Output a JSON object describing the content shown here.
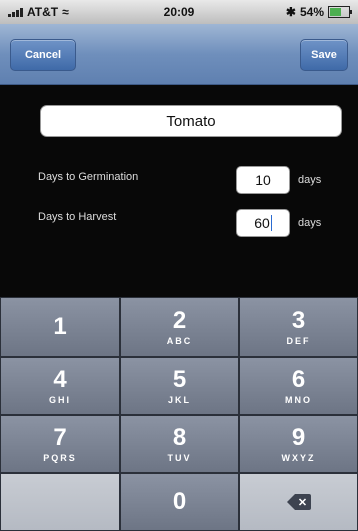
{
  "status_bar": {
    "carrier": "AT&T",
    "time": "20:09",
    "battery_text": "54%"
  },
  "nav": {
    "cancel_label": "Cancel",
    "save_label": "Save"
  },
  "form": {
    "name_value": "Tomato",
    "germination_label": "Days to Germination",
    "germination_value": "10",
    "harvest_label": "Days to Harvest",
    "harvest_value": "60",
    "unit": "days"
  },
  "keypad": {
    "keys": [
      {
        "digit": "1",
        "letters": ""
      },
      {
        "digit": "2",
        "letters": "ABC"
      },
      {
        "digit": "3",
        "letters": "DEF"
      },
      {
        "digit": "4",
        "letters": "GHI"
      },
      {
        "digit": "5",
        "letters": "JKL"
      },
      {
        "digit": "6",
        "letters": "MNO"
      },
      {
        "digit": "7",
        "letters": "PQRS"
      },
      {
        "digit": "8",
        "letters": "TUV"
      },
      {
        "digit": "9",
        "letters": "WXYZ"
      },
      {
        "digit": "0",
        "letters": ""
      }
    ],
    "backspace_icon": "backspace-icon"
  },
  "colors": {
    "nav_blue": "#6f8fbc",
    "keypad_gray": "#7a8292",
    "background": "#0d0d0d"
  }
}
